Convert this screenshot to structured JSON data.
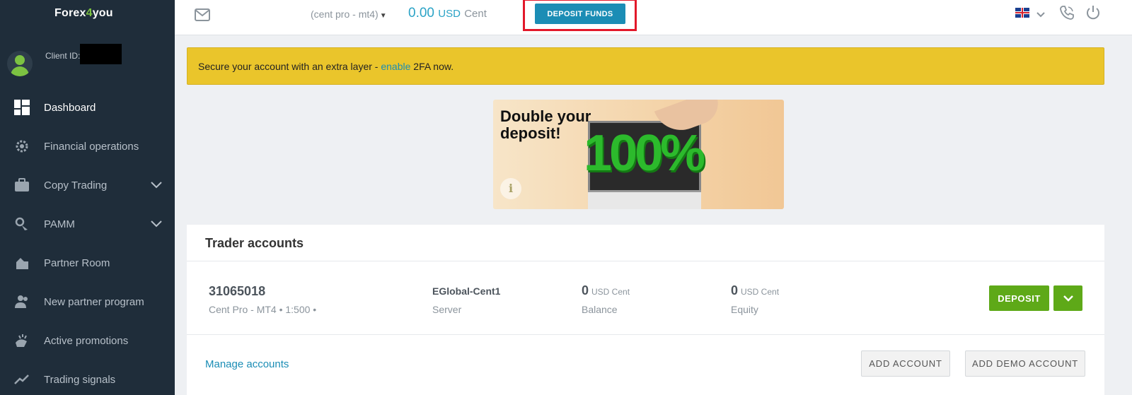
{
  "brand": {
    "logo_a": "Forex",
    "logo_b": "4",
    "logo_c": "you"
  },
  "sidebar": {
    "client_id_label": "Client ID:",
    "items": [
      {
        "label": "Dashboard",
        "icon": "dashboard-icon",
        "active": true
      },
      {
        "label": "Financial operations",
        "icon": "gear-icon"
      },
      {
        "label": "Copy Trading",
        "icon": "briefcase-icon",
        "expandable": true
      },
      {
        "label": "PAMM",
        "icon": "pamm-icon",
        "expandable": true
      },
      {
        "label": "Partner Room",
        "icon": "partner-room-icon"
      },
      {
        "label": "New partner program",
        "icon": "users-icon"
      },
      {
        "label": "Active promotions",
        "icon": "promotions-icon"
      },
      {
        "label": "Trading signals",
        "icon": "trend-icon"
      }
    ]
  },
  "topbar": {
    "account_selector": "(cent pro - mt4)",
    "balance_value": "0.00",
    "balance_currency": "USD",
    "balance_unit": "Cent",
    "deposit_funds_label": "DEPOSIT FUNDS",
    "icons": [
      "mail-icon",
      "uk-flag-icon",
      "phone-icon",
      "power-icon"
    ]
  },
  "alert": {
    "text_before": "Secure your account with an extra layer - ",
    "link": "enable",
    "text_after": " 2FA now."
  },
  "banner": {
    "title": "Double your deposit!",
    "graphic_text": "100%",
    "info_glyph": "i"
  },
  "trader_accounts": {
    "title": "Trader accounts",
    "account": {
      "number": "31065018",
      "meta": "Cent Pro - MT4 • 1:500 •",
      "server_value": "EGlobal-Cent1",
      "server_label": "Server",
      "balance_value": "0",
      "balance_unit": "USD  Cent",
      "balance_label": "Balance",
      "equity_value": "0",
      "equity_unit": "USD  Cent",
      "equity_label": "Equity",
      "deposit_label": "DEPOSIT"
    },
    "manage_label": "Manage accounts",
    "add_account_label": "ADD ACCOUNT",
    "add_demo_label": "ADD DEMO ACCOUNT"
  },
  "colors": {
    "sidebar_bg": "#1f2d3a",
    "accent_blue": "#1b8db5",
    "accent_green": "#5ea918",
    "alert_yellow": "#eac52b",
    "highlight_red": "#e2182a"
  }
}
